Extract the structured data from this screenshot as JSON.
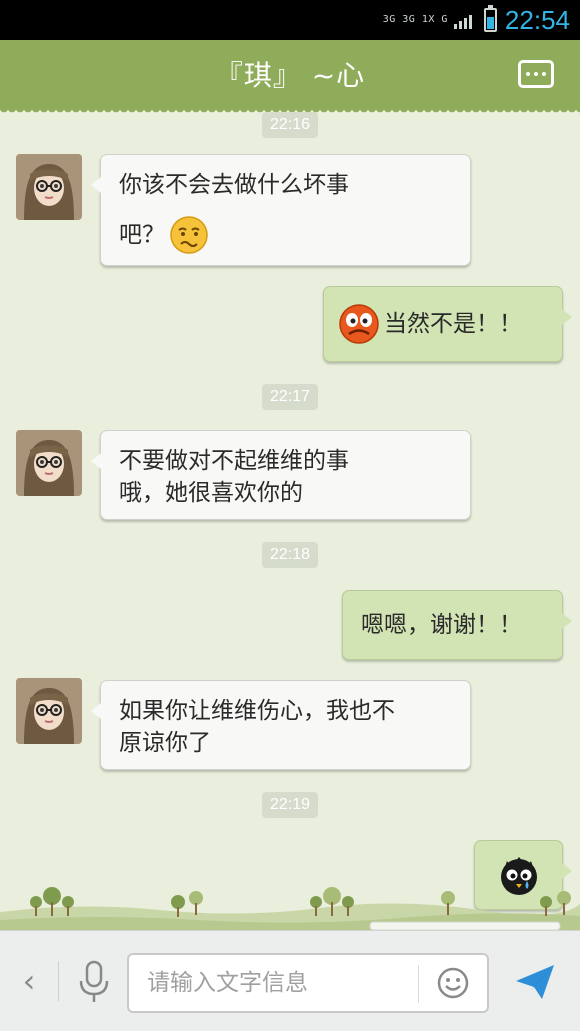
{
  "status_bar": {
    "network_top": "3G 3G 1X G",
    "time": "22:54"
  },
  "header": {
    "title": "『琪』 ~心",
    "menu_icon": "more-icon"
  },
  "messages": [
    {
      "type": "timestamp",
      "text": "22:16"
    },
    {
      "type": "incoming",
      "line1": "你该不会去做什么坏事",
      "line2": "吧？",
      "emoji": "worried-face"
    },
    {
      "type": "outgoing",
      "text": "当然不是！！",
      "emoji": "angry-face"
    },
    {
      "type": "timestamp",
      "text": "22:17"
    },
    {
      "type": "incoming",
      "line1": "不要做对不起维维的事",
      "line2": "哦，她很喜欢你的"
    },
    {
      "type": "timestamp",
      "text": "22:18"
    },
    {
      "type": "outgoing",
      "text": "嗯嗯，谢谢！！"
    },
    {
      "type": "incoming",
      "line1": "如果你让维维伤心，我也不",
      "line2": "原谅你了"
    },
    {
      "type": "timestamp",
      "text": "22:19"
    },
    {
      "type": "outgoing",
      "emoji": "crying-blackbird"
    }
  ],
  "input_bar": {
    "placeholder": "请输入文字信息",
    "back_icon": "chevron-left-icon",
    "mic_icon": "microphone-icon",
    "emoji_icon": "smiley-icon",
    "send_icon": "send-icon"
  },
  "colors": {
    "header": "#8fac5b",
    "background": "#e9efdc",
    "outgoing_bubble": "#d2e3b4",
    "incoming_bubble": "#f8f8f6",
    "accent": "#33b5e5"
  }
}
